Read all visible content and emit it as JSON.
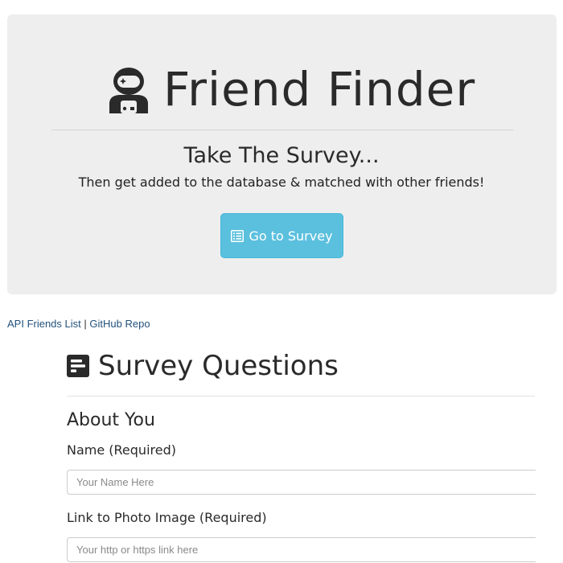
{
  "header": {
    "brand_icon": "astronaut-icon",
    "title": "Friend Finder",
    "heading": "Take The Survey...",
    "subheading": "Then get added to the database & matched with other friends!",
    "survey_button": {
      "icon": "list-alt-icon",
      "label": "Go to Survey"
    }
  },
  "links": {
    "api_label": "API Friends List",
    "separator": "|",
    "github_label": "GitHub Repo"
  },
  "survey": {
    "title_icon": "poll-h-icon",
    "title": "Survey Questions",
    "section_title": "About You",
    "fields": [
      {
        "label": "Name (Required)",
        "placeholder": "Your Name Here"
      },
      {
        "label": "Link to Photo Image (Required)",
        "placeholder": "Your http or https link here"
      }
    ]
  },
  "colors": {
    "button_bg": "#5bc0de",
    "jumbotron_bg": "#eeeeee",
    "link": "#23527c"
  }
}
